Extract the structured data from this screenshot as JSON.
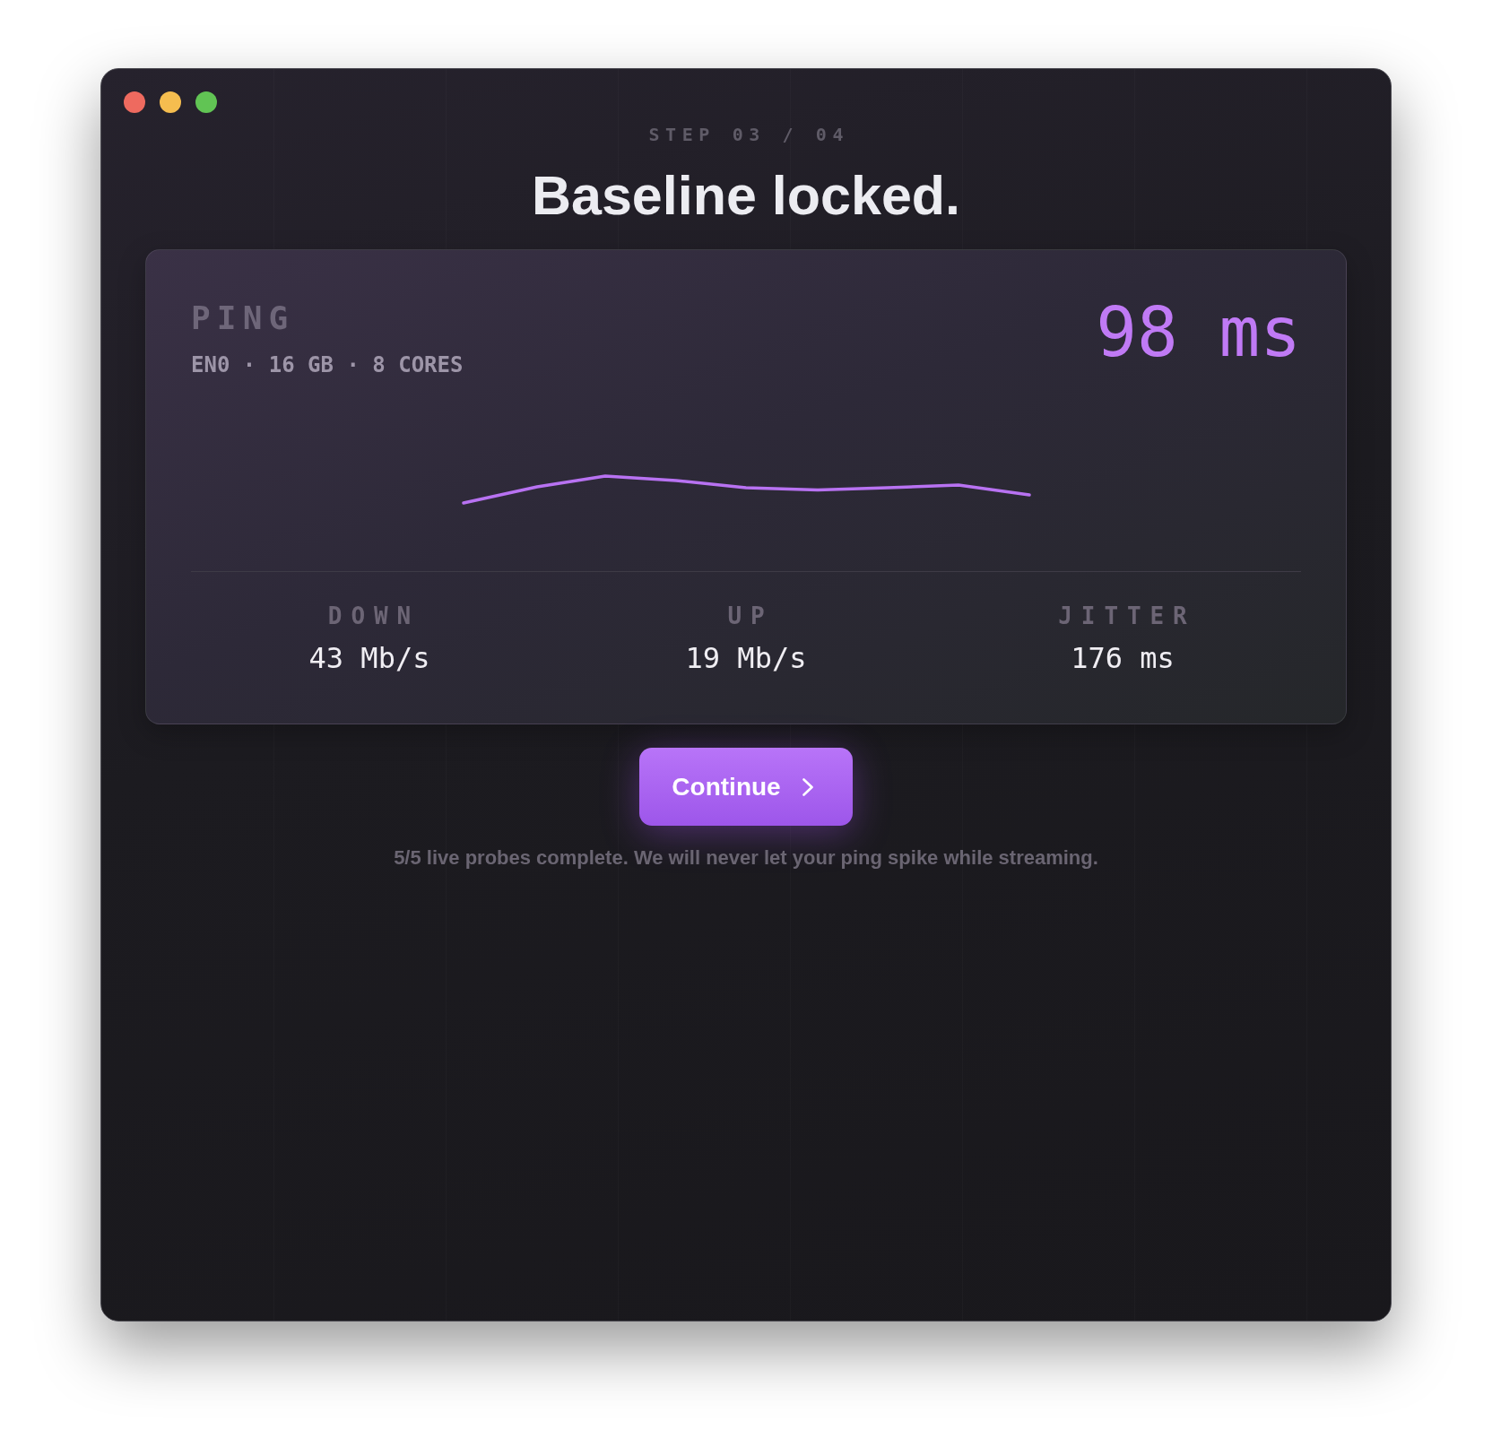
{
  "window": {
    "controls": [
      {
        "color": "#ee6a5f"
      },
      {
        "color": "#f5bd4f"
      },
      {
        "color": "#61c454"
      }
    ]
  },
  "header": {
    "step": "STEP 03 / 04",
    "title": "Baseline locked."
  },
  "metric_card": {
    "label": "PING",
    "details": "EN0 · 16 GB · 8 CORES",
    "reading": "98 ms",
    "stats": [
      {
        "label": "DOWN",
        "value": "43 Mb/s"
      },
      {
        "label": "UP",
        "value": "19 Mb/s"
      },
      {
        "label": "JITTER",
        "value": "176 ms"
      }
    ]
  },
  "continue_button": {
    "label": "Continue"
  },
  "footnote": "5/5 live probes complete. We will never let your ping spike while streaming."
}
